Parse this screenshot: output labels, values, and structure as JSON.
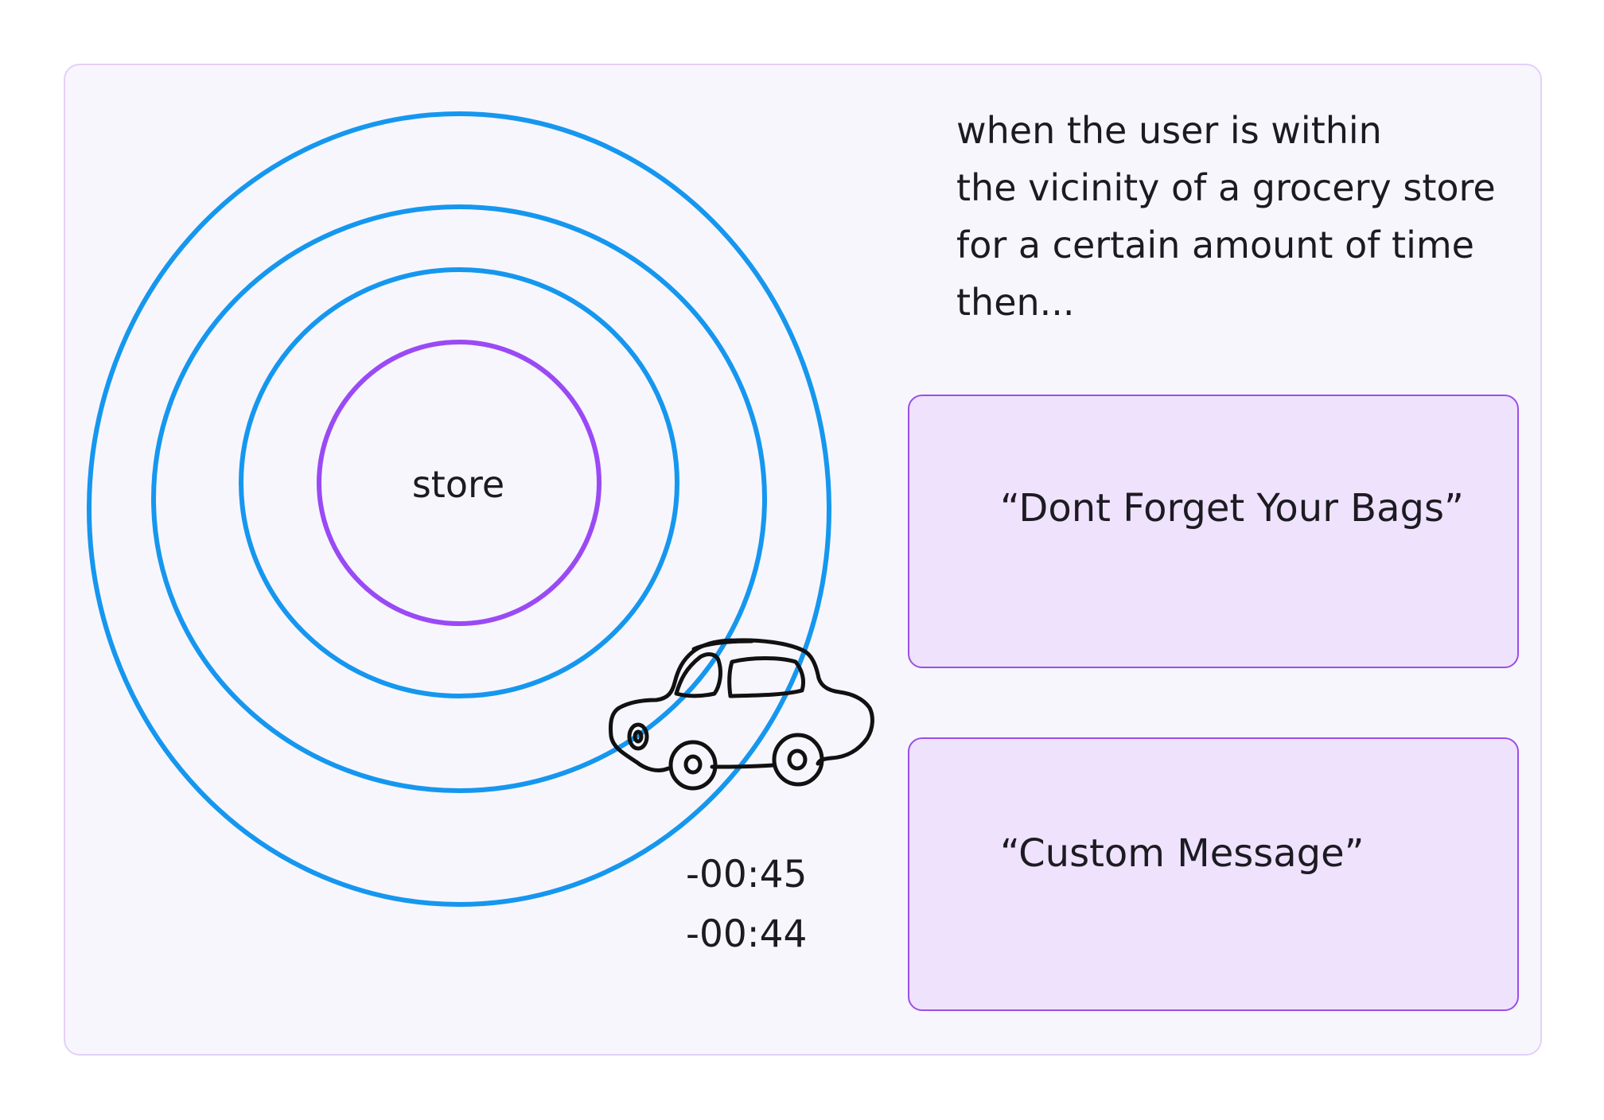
{
  "diagram": {
    "center_label": "store",
    "timers": [
      "-00:45",
      "-00:44"
    ],
    "ring_colors": {
      "inner": "#9a4af5",
      "outer": "#1597ef"
    },
    "vehicle_icon": "car-icon"
  },
  "condition": {
    "lines": [
      "when the user is within",
      "the vicinity of a grocery store",
      "for a certain amount of time",
      "then..."
    ]
  },
  "messages": [
    {
      "text": "“Dont Forget Your Bags”"
    },
    {
      "text": "“Custom Message”"
    }
  ]
}
